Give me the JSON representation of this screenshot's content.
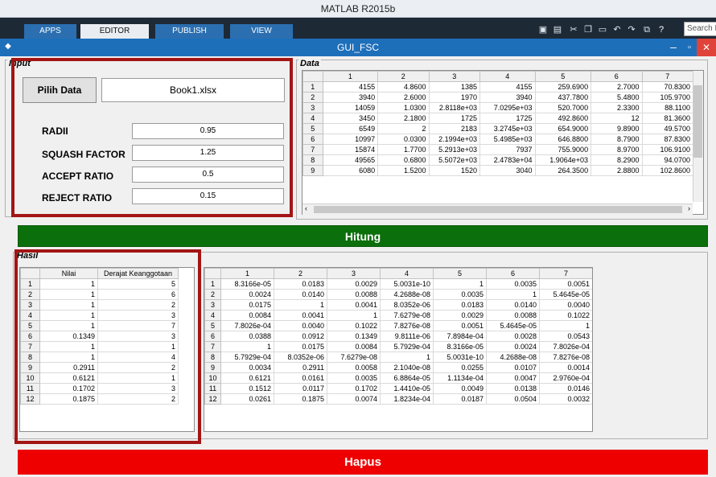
{
  "app_title": "MATLAB R2015b",
  "ribbon": {
    "tabs": [
      "APPS",
      "EDITOR",
      "PUBLISH",
      "VIEW"
    ],
    "search_placeholder": "Search D"
  },
  "window": {
    "title": "GUI_FSC"
  },
  "input_panel": {
    "title": "Input",
    "pilih_button": "Pilih Data",
    "filename": "Book1.xlsx",
    "params": [
      {
        "label": "RADII",
        "value": "0.95"
      },
      {
        "label": "SQUASH FACTOR",
        "value": "1.25"
      },
      {
        "label": "ACCEPT RATIO",
        "value": "0.5"
      },
      {
        "label": "REJECT RATIO",
        "value": "0.15"
      }
    ]
  },
  "data_panel": {
    "title": "Data",
    "columns": [
      "1",
      "2",
      "3",
      "4",
      "5",
      "6",
      "7"
    ],
    "rows": [
      {
        "id": "1",
        "cells": [
          "4155",
          "4.8600",
          "1385",
          "4155",
          "259.6900",
          "2.7000",
          "70.8300"
        ]
      },
      {
        "id": "2",
        "cells": [
          "3940",
          "2.6000",
          "1970",
          "3940",
          "437.7800",
          "5.4800",
          "105.9700"
        ]
      },
      {
        "id": "3",
        "cells": [
          "14059",
          "1.0300",
          "2.8118e+03",
          "7.0295e+03",
          "520.7000",
          "2.3300",
          "88.1100"
        ]
      },
      {
        "id": "4",
        "cells": [
          "3450",
          "2.1800",
          "1725",
          "1725",
          "492.8600",
          "12",
          "81.3600"
        ]
      },
      {
        "id": "5",
        "cells": [
          "6549",
          "2",
          "2183",
          "3.2745e+03",
          "654.9000",
          "9.8900",
          "49.5700"
        ]
      },
      {
        "id": "6",
        "cells": [
          "10997",
          "0.0300",
          "2.1994e+03",
          "5.4985e+03",
          "646.8800",
          "8.7900",
          "87.8300"
        ]
      },
      {
        "id": "7",
        "cells": [
          "15874",
          "1.7700",
          "5.2913e+03",
          "7937",
          "755.9000",
          "8.9700",
          "106.9100"
        ]
      },
      {
        "id": "8",
        "cells": [
          "49565",
          "0.6800",
          "5.5072e+03",
          "2.4783e+04",
          "1.9064e+03",
          "8.2900",
          "94.0700"
        ]
      },
      {
        "id": "9",
        "cells": [
          "6080",
          "1.5200",
          "1520",
          "3040",
          "264.3500",
          "2.8800",
          "102.8600"
        ]
      }
    ]
  },
  "hitung_button": "Hitung",
  "hasil_panel": {
    "title": "Hasil",
    "left_columns": [
      "Nilai",
      "Derajat Keanggotaan"
    ],
    "left_rows": [
      {
        "id": "1",
        "cells": [
          "1",
          "5"
        ]
      },
      {
        "id": "2",
        "cells": [
          "1",
          "6"
        ]
      },
      {
        "id": "3",
        "cells": [
          "1",
          "2"
        ]
      },
      {
        "id": "4",
        "cells": [
          "1",
          "3"
        ]
      },
      {
        "id": "5",
        "cells": [
          "1",
          "7"
        ]
      },
      {
        "id": "6",
        "cells": [
          "0.1349",
          "3"
        ]
      },
      {
        "id": "7",
        "cells": [
          "1",
          "1"
        ]
      },
      {
        "id": "8",
        "cells": [
          "1",
          "4"
        ]
      },
      {
        "id": "9",
        "cells": [
          "0.2911",
          "2"
        ]
      },
      {
        "id": "10",
        "cells": [
          "0.6121",
          "1"
        ]
      },
      {
        "id": "11",
        "cells": [
          "0.1702",
          "3"
        ]
      },
      {
        "id": "12",
        "cells": [
          "0.1875",
          "2"
        ]
      }
    ],
    "right_columns": [
      "1",
      "2",
      "3",
      "4",
      "5",
      "6",
      "7"
    ],
    "right_rows": [
      {
        "id": "1",
        "cells": [
          "8.3166e-05",
          "0.0183",
          "0.0029",
          "5.0031e-10",
          "1",
          "0.0035",
          "0.0051"
        ]
      },
      {
        "id": "2",
        "cells": [
          "0.0024",
          "0.0140",
          "0.0088",
          "4.2688e-08",
          "0.0035",
          "1",
          "5.4645e-05"
        ]
      },
      {
        "id": "3",
        "cells": [
          "0.0175",
          "1",
          "0.0041",
          "8.0352e-06",
          "0.0183",
          "0.0140",
          "0.0040"
        ]
      },
      {
        "id": "4",
        "cells": [
          "0.0084",
          "0.0041",
          "1",
          "7.6279e-08",
          "0.0029",
          "0.0088",
          "0.1022"
        ]
      },
      {
        "id": "5",
        "cells": [
          "7.8026e-04",
          "0.0040",
          "0.1022",
          "7.8276e-08",
          "0.0051",
          "5.4645e-05",
          "1"
        ]
      },
      {
        "id": "6",
        "cells": [
          "0.0388",
          "0.0912",
          "0.1349",
          "9.8111e-06",
          "7.8984e-04",
          "0.0028",
          "0.0543"
        ]
      },
      {
        "id": "7",
        "cells": [
          "1",
          "0.0175",
          "0.0084",
          "5.7929e-04",
          "8.3166e-05",
          "0.0024",
          "7.8026e-04"
        ]
      },
      {
        "id": "8",
        "cells": [
          "5.7929e-04",
          "8.0352e-06",
          "7.6279e-08",
          "1",
          "5.0031e-10",
          "4.2688e-08",
          "7.8276e-08"
        ]
      },
      {
        "id": "9",
        "cells": [
          "0.0034",
          "0.2911",
          "0.0058",
          "2.1040e-08",
          "0.0255",
          "0.0107",
          "0.0014"
        ]
      },
      {
        "id": "10",
        "cells": [
          "0.6121",
          "0.0161",
          "0.0035",
          "6.8864e-05",
          "1.1134e-04",
          "0.0047",
          "2.9760e-04"
        ]
      },
      {
        "id": "11",
        "cells": [
          "0.1512",
          "0.0117",
          "0.1702",
          "1.4410e-05",
          "0.0049",
          "0.0138",
          "0.0146"
        ]
      },
      {
        "id": "12",
        "cells": [
          "0.0261",
          "0.1875",
          "0.0074",
          "1.8234e-04",
          "0.0187",
          "0.0504",
          "0.0032"
        ]
      }
    ]
  },
  "hapus_button": "Hapus",
  "colors": {
    "highlight": "#a31515",
    "hitung": "#0b6f0b",
    "hapus": "#ee0000",
    "title_bar": "#1d6fba"
  }
}
